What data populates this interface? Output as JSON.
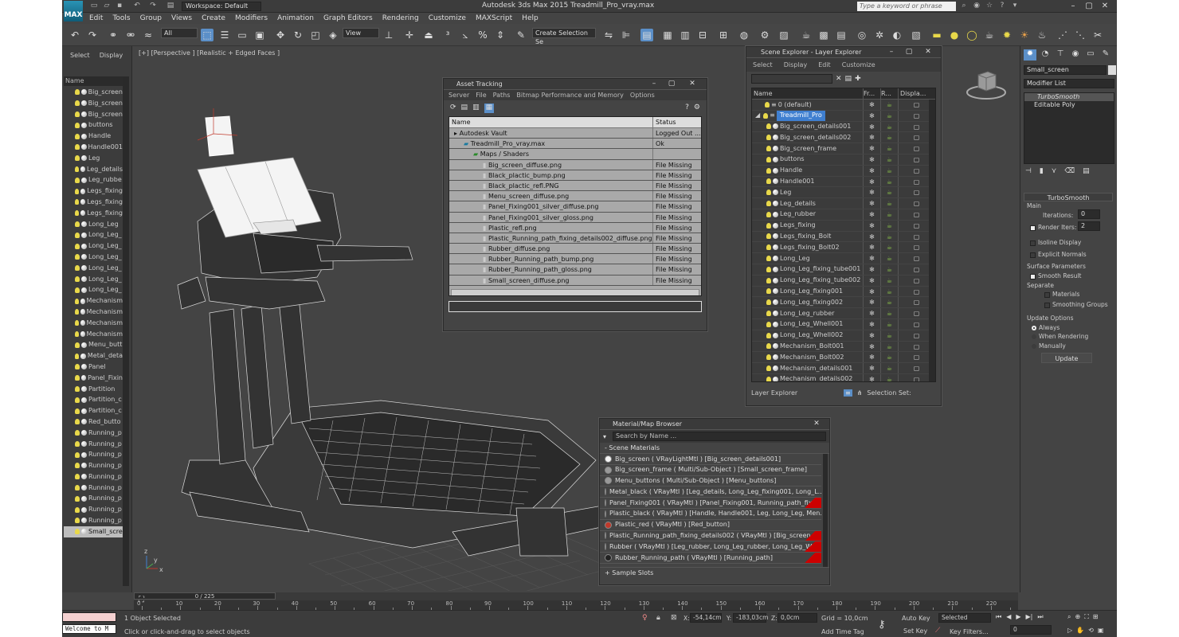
{
  "titlebar": {
    "logo": "MAX",
    "workspace": "Workspace: Default",
    "title": "Autodesk 3ds Max 2015     Treadmill_Pro_vray.max",
    "search_placeholder": "Type a keyword or phrase"
  },
  "menu": [
    "Edit",
    "Tools",
    "Group",
    "Views",
    "Create",
    "Modifiers",
    "Animation",
    "Graph Editors",
    "Rendering",
    "Customize",
    "MAXScript",
    "Help"
  ],
  "toolbar": {
    "filter": "All",
    "view": "View",
    "selection_set": "Create Selection Se"
  },
  "left_panel": {
    "tabs": [
      "Select",
      "Display"
    ],
    "column": "Name",
    "items": [
      "Big_screen",
      "Big_screen",
      "Big_screen",
      "buttons",
      "Handle",
      "Handle001",
      "Leg",
      "Leg_details",
      "Leg_rubbe",
      "Legs_fixing",
      "Legs_fixing",
      "Legs_fixing",
      "Long_Leg",
      "Long_Leg_",
      "Long_Leg_",
      "Long_Leg_",
      "Long_Leg_",
      "Long_Leg_",
      "Long_Leg_",
      "Mechanism",
      "Mechanism",
      "Mechanism",
      "Mechanism",
      "Menu_butt",
      "Metal_deta",
      "Panel",
      "Panel_Fixin",
      "Partition",
      "Partition_c",
      "Partition_c",
      "Red_butto",
      "Running_p",
      "Running_p",
      "Running_p",
      "Running_p",
      "Running_p",
      "Running_p",
      "Running_p",
      "Running_p",
      "Running_p",
      "Small_scre"
    ]
  },
  "viewport": {
    "label": "[+] [Perspective ] [Realistic + Edged Faces ]",
    "axis_x": "x",
    "axis_y": "y",
    "axis_z": "z"
  },
  "asset_tracking": {
    "title": "Asset Tracking",
    "menu": [
      "Server",
      "File",
      "Paths",
      "Bitmap Performance and Memory",
      "Options"
    ],
    "columns": [
      "Name",
      "Status"
    ],
    "rows": [
      {
        "name": "Autodesk Vault",
        "status": "Logged Out ...",
        "indent": 0
      },
      {
        "name": "Treadmill_Pro_vray.max",
        "status": "Ok",
        "indent": 1
      },
      {
        "name": "Maps / Shaders",
        "status": "",
        "indent": 2
      },
      {
        "name": "Big_screen_diffuse.png",
        "status": "File Missing",
        "indent": 3
      },
      {
        "name": "Black_plactic_bump.png",
        "status": "File Missing",
        "indent": 3
      },
      {
        "name": "Black_plactic_refl.PNG",
        "status": "File Missing",
        "indent": 3
      },
      {
        "name": "Menu_screen_diffuse.png",
        "status": "File Missing",
        "indent": 3
      },
      {
        "name": "Panel_Fixing001_silver_diffuse.png",
        "status": "File Missing",
        "indent": 3
      },
      {
        "name": "Panel_Fixing001_silver_gloss.png",
        "status": "File Missing",
        "indent": 3
      },
      {
        "name": "Plastic_refl.png",
        "status": "File Missing",
        "indent": 3
      },
      {
        "name": "Plastic_Running_path_fixing_details002_diffuse.png",
        "status": "File Missing",
        "indent": 3
      },
      {
        "name": "Rubber_diffuse.png",
        "status": "File Missing",
        "indent": 3
      },
      {
        "name": "Rubber_Running_path_bump.png",
        "status": "File Missing",
        "indent": 3
      },
      {
        "name": "Rubber_Running_path_gloss.png",
        "status": "File Missing",
        "indent": 3
      },
      {
        "name": "Small_screen_diffuse.png",
        "status": "File Missing",
        "indent": 3
      }
    ]
  },
  "scene_explorer": {
    "title": "Scene Explorer - Layer Explorer",
    "menu": [
      "Select",
      "Display",
      "Edit",
      "Customize"
    ],
    "columns": [
      "Name",
      "Fr...",
      "R...",
      "Displa..."
    ],
    "layer_default": "0 (default)",
    "layer_active": "Treadmill_Pro",
    "items": [
      "Big_screen_details001",
      "Big_screen_details002",
      "Big_screen_frame",
      "buttons",
      "Handle",
      "Handle001",
      "Leg",
      "Leg_details",
      "Leg_rubber",
      "Legs_fixing",
      "Legs_fixing_Bolt",
      "Legs_fixing_Bolt02",
      "Long_Leg",
      "Long_Leg_fixing_tube001",
      "Long_Leg_fixing_tube002",
      "Long_Leg_fixing001",
      "Long_Leg_fixing002",
      "Long_Leg_rubber",
      "Long_Leg_Whell001",
      "Long_Leg_Whell002",
      "Mechanism_Bolt001",
      "Mechanism_Bolt002",
      "Mechanism_details001",
      "Mechanism_details002"
    ],
    "footer_left": "Layer Explorer",
    "footer_right": "Selection Set:"
  },
  "material_browser": {
    "title": "Material/Map Browser",
    "search": "Search by Name ...",
    "section": "- Scene Materials",
    "items": [
      {
        "text": "Big_screen  ( VRayLightMtl ) [Big_screen_details001]",
        "color": "#f5f5f5",
        "red": false
      },
      {
        "text": "Big_screen_frame  ( Multi/Sub-Object ) [Small_screen_frame]",
        "color": "#999999",
        "red": false
      },
      {
        "text": "Menu_buttons  ( Multi/Sub-Object ) [Menu_buttons]",
        "color": "#999999",
        "red": false
      },
      {
        "text": "Metal_black  ( VRayMtl ) [Leg_details, Long_Leg_fixing001, Long_L...",
        "color": "#222222",
        "red": false
      },
      {
        "text": "Panel_Fixing001  ( VRayMtl ) [Panel_Fixing001, Running_path_fixing]",
        "color": "#222222",
        "red": true
      },
      {
        "text": "Plastic_black  ( VRayMtl ) [Handle, Handle001, Leg, Long_Leg, Men...",
        "color": "#222222",
        "red": false
      },
      {
        "text": "Plastic_red  ( VRayMtl ) [Red_button]",
        "color": "#c0392b",
        "red": false
      },
      {
        "text": "Plastic_Running_path_fixing_details002  ( VRayMtl ) [Big_screen_fr...",
        "color": "#222222",
        "red": true
      },
      {
        "text": "Rubber  ( VRayMtl ) [Leg_rubber, Long_Leg_rubber, Long_Leg_Wh...",
        "color": "#222222",
        "red": true
      },
      {
        "text": "Rubber_Running_path  ( VRayMtl ) [Running_path]",
        "color": "#222222",
        "red": true
      }
    ],
    "footer": "+ Sample Slots"
  },
  "command_panel": {
    "object_name": "Small_screen",
    "modifier_list": "Modifier List",
    "stack": [
      "TurboSmooth",
      "Editable Poly"
    ],
    "rollout": "TurboSmooth",
    "main": "Main",
    "iterations_label": "Iterations:",
    "iterations": "0",
    "render_iters_label": "Render Iters:",
    "render_iters": "2",
    "isoline": "Isoline Display",
    "explicit": "Explicit Normals",
    "surface_params": "Surface Parameters",
    "smooth_result": "Smooth Result",
    "separate": "Separate",
    "materials": "Materials",
    "smoothing_groups": "Smoothing Groups",
    "update_options": "Update Options",
    "always": "Always",
    "when_rendering": "When Rendering",
    "manually": "Manually",
    "update": "Update"
  },
  "timeline": {
    "frame": "0 / 225",
    "ticks": [
      "0",
      "10",
      "20",
      "30",
      "40",
      "50",
      "60",
      "70",
      "80",
      "90",
      "100",
      "110",
      "120",
      "130",
      "140",
      "150",
      "160",
      "170",
      "180",
      "190",
      "200",
      "210",
      "220"
    ]
  },
  "status": {
    "listener": "Welcome to M",
    "selected": "1 Object Selected",
    "hint": "Click or click-and-drag to select objects",
    "x": "-54,14cm",
    "y": "-183,03cm",
    "z": "0,0cm",
    "grid": "Grid = 10,0cm",
    "add_time_tag": "Add Time Tag",
    "auto_key": "Auto Key",
    "set_key": "Set Key",
    "selected_dd": "Selected",
    "key_filters": "Key Filters...",
    "frame_value": "0"
  }
}
